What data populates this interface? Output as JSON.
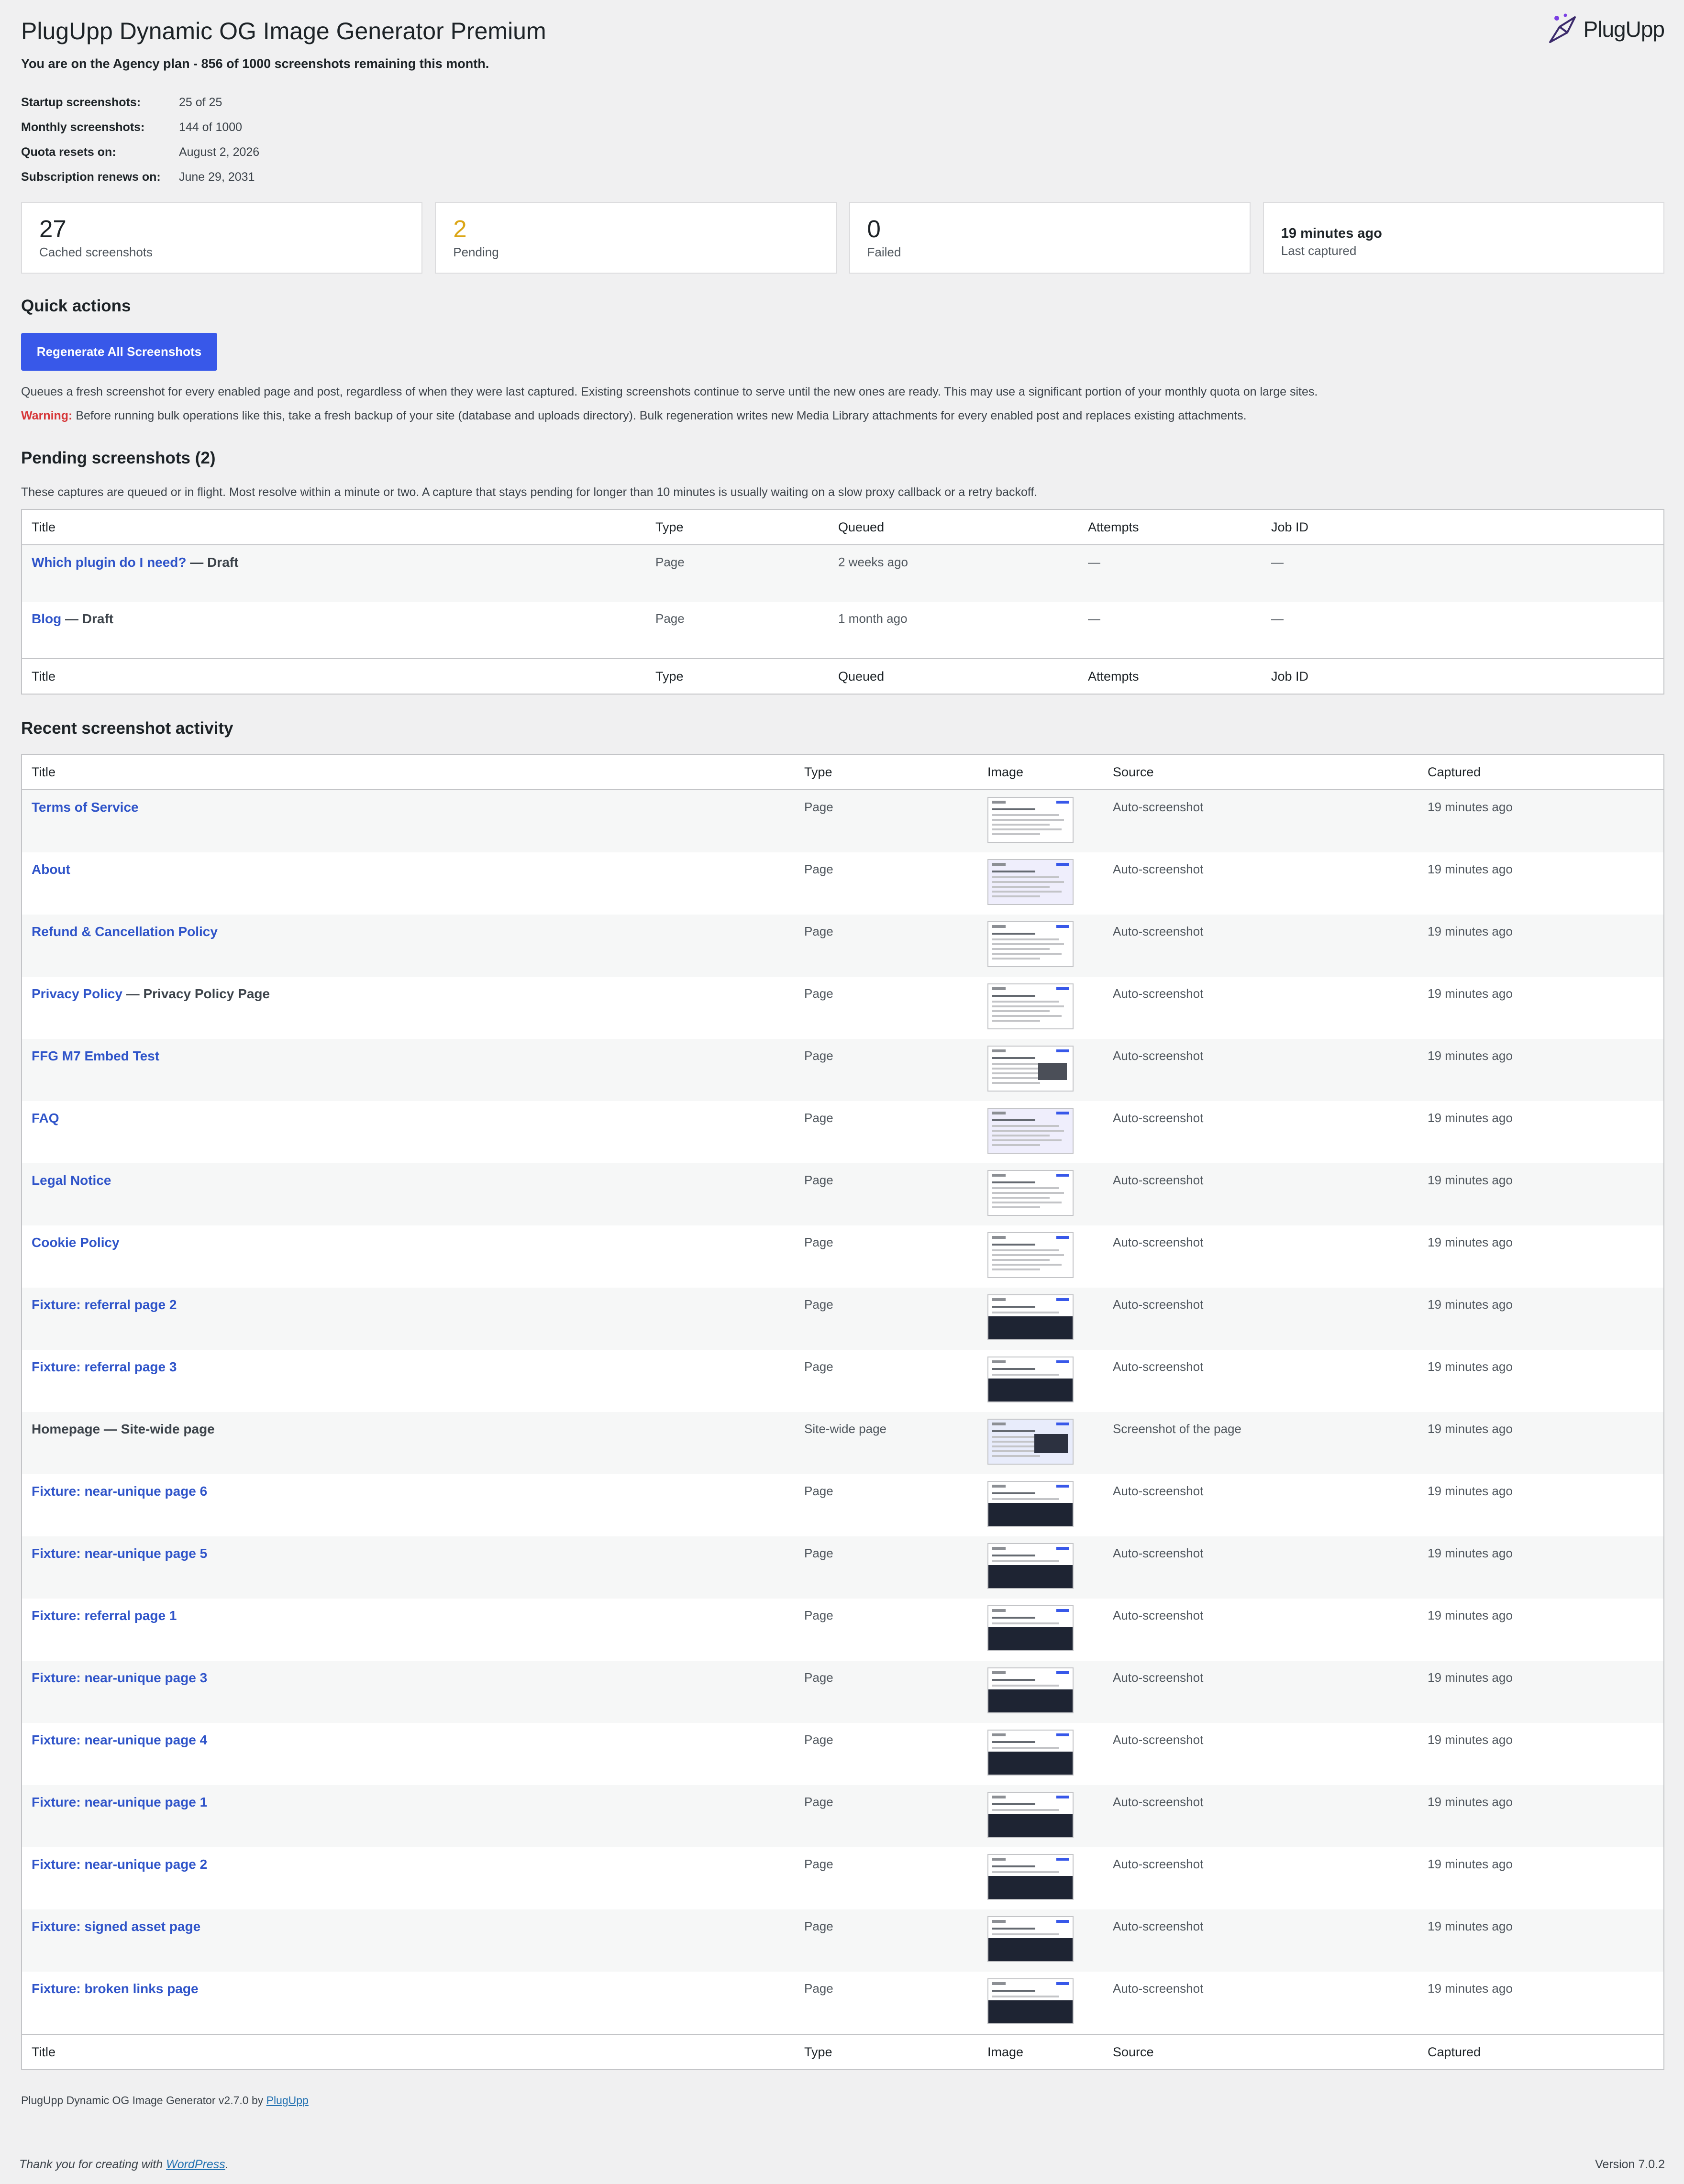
{
  "page": {
    "title": "PlugUpp Dynamic OG Image Generator Premium",
    "brand": "PlugUpp",
    "plan_line": "You are on the Agency plan - 856 of 1000 screenshots remaining this month."
  },
  "info": [
    {
      "label": "Startup screenshots:",
      "value": "25 of 25"
    },
    {
      "label": "Monthly screenshots:",
      "value": "144 of 1000"
    },
    {
      "label": "Quota resets on:",
      "value": "August 2, 2026"
    },
    {
      "label": "Subscription renews on:",
      "value": "June 29, 2031"
    }
  ],
  "stats": {
    "cached": {
      "value": "27",
      "label": "Cached screenshots"
    },
    "pending": {
      "value": "2",
      "label": "Pending"
    },
    "failed": {
      "value": "0",
      "label": "Failed"
    },
    "last": {
      "value": "19 minutes ago",
      "label": "Last captured"
    }
  },
  "quick": {
    "heading": "Quick actions",
    "button": "Regenerate All Screenshots",
    "desc": "Queues a fresh screenshot for every enabled page and post, regardless of when they were last captured. Existing screenshots continue to serve until the new ones are ready. This may use a significant portion of your monthly quota on large sites.",
    "warning_label": "Warning:",
    "warning_text": " Before running bulk operations like this, take a fresh backup of your site (database and uploads directory). Bulk regeneration writes new Media Library attachments for every enabled post and replaces existing attachments."
  },
  "pending": {
    "heading": "Pending screenshots (2)",
    "desc": "These captures are queued or in flight. Most resolve within a minute or two. A capture that stays pending for longer than 10 minutes is usually waiting on a slow proxy callback or a retry backoff.",
    "columns": [
      "Title",
      "Type",
      "Queued",
      "Attempts",
      "Job ID"
    ],
    "rows": [
      {
        "link": "Which plugin do I need?",
        "suffix": " — Draft",
        "type": "Page",
        "queued": "2 weeks ago",
        "attempts": "—",
        "job": "—"
      },
      {
        "link": "Blog",
        "suffix": " — Draft",
        "type": "Page",
        "queued": "1 month ago",
        "attempts": "—",
        "job": "—"
      }
    ]
  },
  "activity": {
    "heading": "Recent screenshot activity",
    "columns": [
      "Title",
      "Type",
      "Image",
      "Source",
      "Captured"
    ],
    "rows": [
      {
        "link": "Terms of Service",
        "suffix": "",
        "type": "Page",
        "thumb": "doc",
        "source": "Auto-screenshot",
        "captured": "19 minutes ago"
      },
      {
        "link": "About",
        "suffix": "",
        "type": "Page",
        "thumb": "purple",
        "source": "Auto-screenshot",
        "captured": "19 minutes ago"
      },
      {
        "link": "Refund & Cancellation Policy",
        "suffix": "",
        "type": "Page",
        "thumb": "doc",
        "source": "Auto-screenshot",
        "captured": "19 minutes ago"
      },
      {
        "link": "Privacy Policy",
        "suffix": " — Privacy Policy Page",
        "type": "Page",
        "thumb": "doc",
        "source": "Auto-screenshot",
        "captured": "19 minutes ago"
      },
      {
        "link": "FFG M7 Embed Test",
        "suffix": "",
        "type": "Page",
        "thumb": "hero",
        "source": "Auto-screenshot",
        "captured": "19 minutes ago"
      },
      {
        "link": "FAQ",
        "suffix": "",
        "type": "Page",
        "thumb": "purple",
        "source": "Auto-screenshot",
        "captured": "19 minutes ago"
      },
      {
        "link": "Legal Notice",
        "suffix": "",
        "type": "Page",
        "thumb": "doc",
        "source": "Auto-screenshot",
        "captured": "19 minutes ago"
      },
      {
        "link": "Cookie Policy",
        "suffix": "",
        "type": "Page",
        "thumb": "doc",
        "source": "Auto-screenshot",
        "captured": "19 minutes ago"
      },
      {
        "link": "Fixture: referral page 2",
        "suffix": "",
        "type": "Page",
        "thumb": "dark",
        "source": "Auto-screenshot",
        "captured": "19 minutes ago"
      },
      {
        "link": "Fixture: referral page 3",
        "suffix": "",
        "type": "Page",
        "thumb": "dark",
        "source": "Auto-screenshot",
        "captured": "19 minutes ago"
      },
      {
        "link": "",
        "suffix": "Homepage — Site-wide page",
        "type": "Site-wide page",
        "thumb": "home",
        "source": "Screenshot of the page",
        "captured": "19 minutes ago"
      },
      {
        "link": "Fixture: near-unique page 6",
        "suffix": "",
        "type": "Page",
        "thumb": "dark",
        "source": "Auto-screenshot",
        "captured": "19 minutes ago"
      },
      {
        "link": "Fixture: near-unique page 5",
        "suffix": "",
        "type": "Page",
        "thumb": "dark",
        "source": "Auto-screenshot",
        "captured": "19 minutes ago"
      },
      {
        "link": "Fixture: referral page 1",
        "suffix": "",
        "type": "Page",
        "thumb": "dark",
        "source": "Auto-screenshot",
        "captured": "19 minutes ago"
      },
      {
        "link": "Fixture: near-unique page 3",
        "suffix": "",
        "type": "Page",
        "thumb": "dark",
        "source": "Auto-screenshot",
        "captured": "19 minutes ago"
      },
      {
        "link": "Fixture: near-unique page 4",
        "suffix": "",
        "type": "Page",
        "thumb": "dark",
        "source": "Auto-screenshot",
        "captured": "19 minutes ago"
      },
      {
        "link": "Fixture: near-unique page 1",
        "suffix": "",
        "type": "Page",
        "thumb": "dark",
        "source": "Auto-screenshot",
        "captured": "19 minutes ago"
      },
      {
        "link": "Fixture: near-unique page 2",
        "suffix": "",
        "type": "Page",
        "thumb": "dark",
        "source": "Auto-screenshot",
        "captured": "19 minutes ago"
      },
      {
        "link": "Fixture: signed asset page",
        "suffix": "",
        "type": "Page",
        "thumb": "dark",
        "source": "Auto-screenshot",
        "captured": "19 minutes ago"
      },
      {
        "link": "Fixture: broken links page",
        "suffix": "",
        "type": "Page",
        "thumb": "dark",
        "source": "Auto-screenshot",
        "captured": "19 minutes ago"
      }
    ]
  },
  "footer": {
    "plugin_text": "PlugUpp Dynamic OG Image Generator v2.7.0 by ",
    "plugin_link": "PlugUpp",
    "thanks_text": "Thank you for creating with ",
    "thanks_link": "WordPress",
    "thanks_end": ".",
    "version": "Version 7.0.2"
  },
  "colors": {
    "accent": "#3858e9",
    "link": "#2f54c9",
    "warning": "#d63638",
    "pending": "#dba617"
  }
}
